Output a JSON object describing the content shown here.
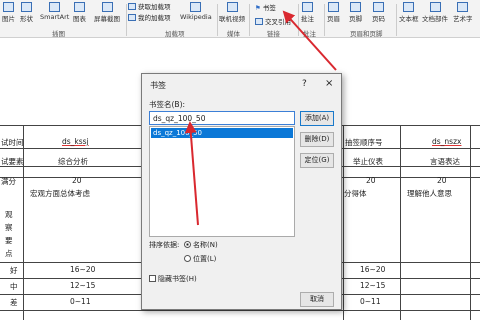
{
  "ribbon": {
    "buttons": [
      "图片",
      "形状",
      "SmartArt",
      "图表",
      "屏幕截图"
    ],
    "addin_get": "获取加载项",
    "addin_my": "我的加载项",
    "wikipedia": "Wikipedia",
    "video": "联机视频",
    "link_bookmark": "书签",
    "link_crossref": "交叉引用",
    "comment": "批注",
    "header": "页眉",
    "footer": "页脚",
    "pagenum": "页码",
    "textbox": "文本框",
    "docparts": "文档部件",
    "wordart": "艺术字",
    "groups": {
      "illustrations": "插图",
      "addins": "加载项",
      "media": "媒体",
      "links": "链接",
      "comments": "批注",
      "headerfooter": "页眉和页脚"
    }
  },
  "table": {
    "left_labels": [
      "试时间",
      "试要素",
      "满分"
    ],
    "cells": [
      "ds_kssj",
      "综合分析",
      "20",
      "宏观方面总体考虑",
      "分得体",
      "理解他人意思",
      "抽签顺序号",
      "ds_nszx",
      "举止仪表",
      "言语表达",
      "20",
      "20"
    ],
    "observe": "观察要点",
    "ratings": [
      "好",
      "中",
      "差"
    ],
    "scores": [
      "16~20",
      "12~15",
      "0~11",
      "16~20",
      "12~15",
      "0~11"
    ]
  },
  "dialog": {
    "title": "书签",
    "help": "?",
    "close": "×",
    "name_label": "书签名(B):",
    "name_value": "ds_qz_100_50",
    "list": [
      "ds_qz_100_50"
    ],
    "buttons": {
      "add": "添加(A)",
      "delete": "删除(D)",
      "goto": "定位(G)",
      "cancel": "取消"
    },
    "sort_label": "排序依据:",
    "sort_name": "名称(N)",
    "sort_location": "位置(L)",
    "hidden": "隐藏书签(H)"
  },
  "colors": {
    "arrow": "#d9282f",
    "selection": "#0b78d7"
  }
}
